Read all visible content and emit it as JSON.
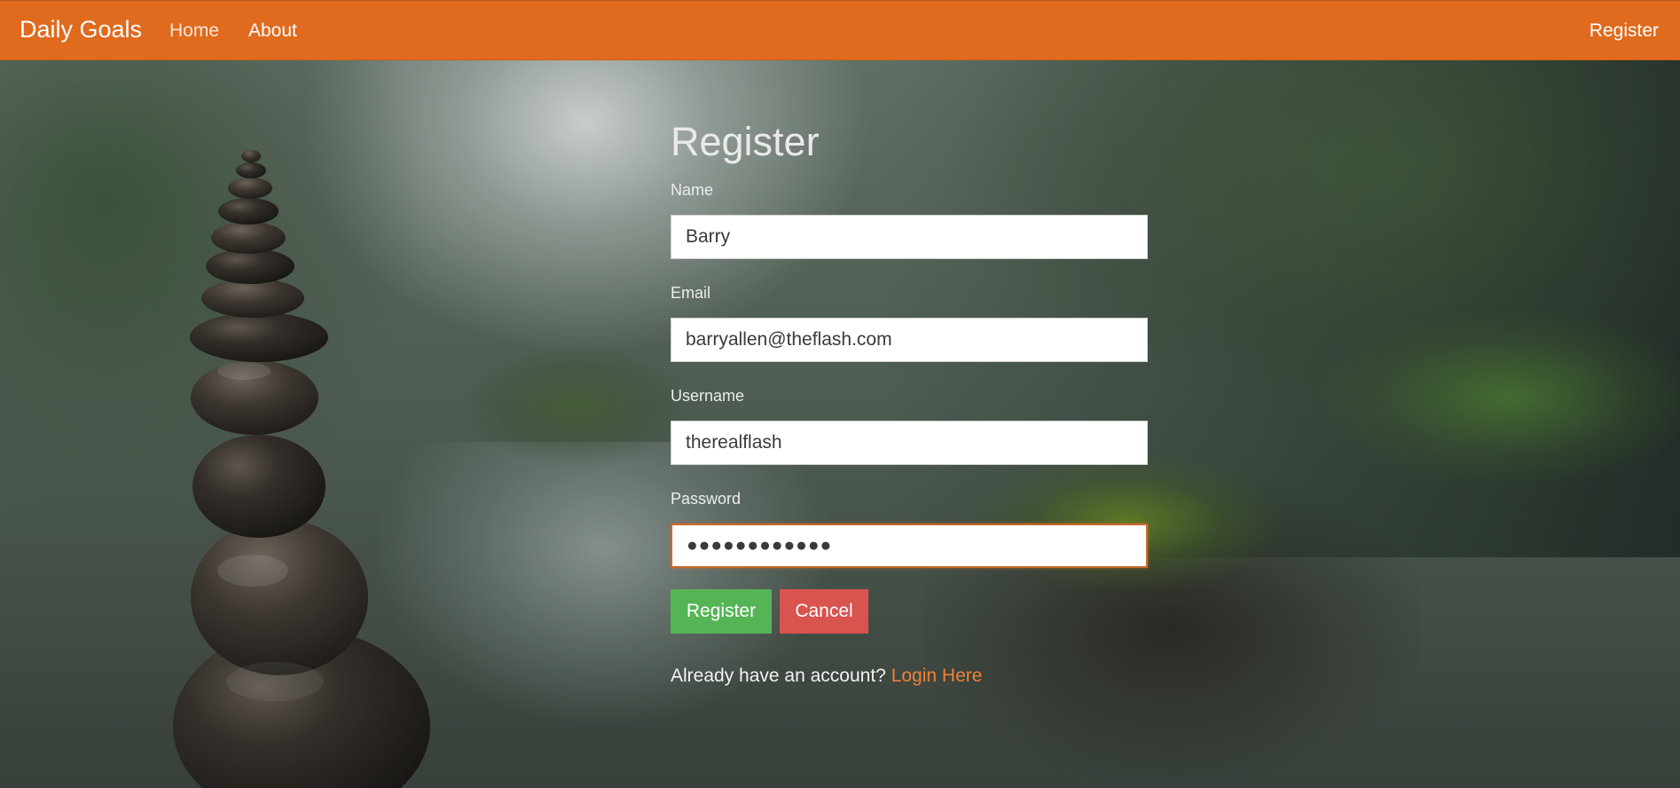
{
  "navbar": {
    "brand": "Daily Goals",
    "links": [
      {
        "label": "Home"
      },
      {
        "label": "About"
      }
    ],
    "right_link": "Register",
    "color": "#e06a1e"
  },
  "form": {
    "title": "Register",
    "fields": [
      {
        "label": "Name",
        "value": "Barry",
        "type": "text"
      },
      {
        "label": "Email",
        "value": "barryallen@theflash.com",
        "type": "email"
      },
      {
        "label": "Username",
        "value": "therealflash",
        "type": "text"
      },
      {
        "label": "Password",
        "value": "●●●●●●●●●●●●",
        "type": "password",
        "focused": true
      }
    ],
    "buttons": {
      "register": "Register",
      "cancel": "Cancel"
    },
    "login_prompt": "Already have an account?",
    "login_link": "Login Here"
  },
  "colors": {
    "accent": "#e06a1e",
    "register_button": "#55b556",
    "cancel_button": "#d9534f",
    "link": "#f08235"
  }
}
